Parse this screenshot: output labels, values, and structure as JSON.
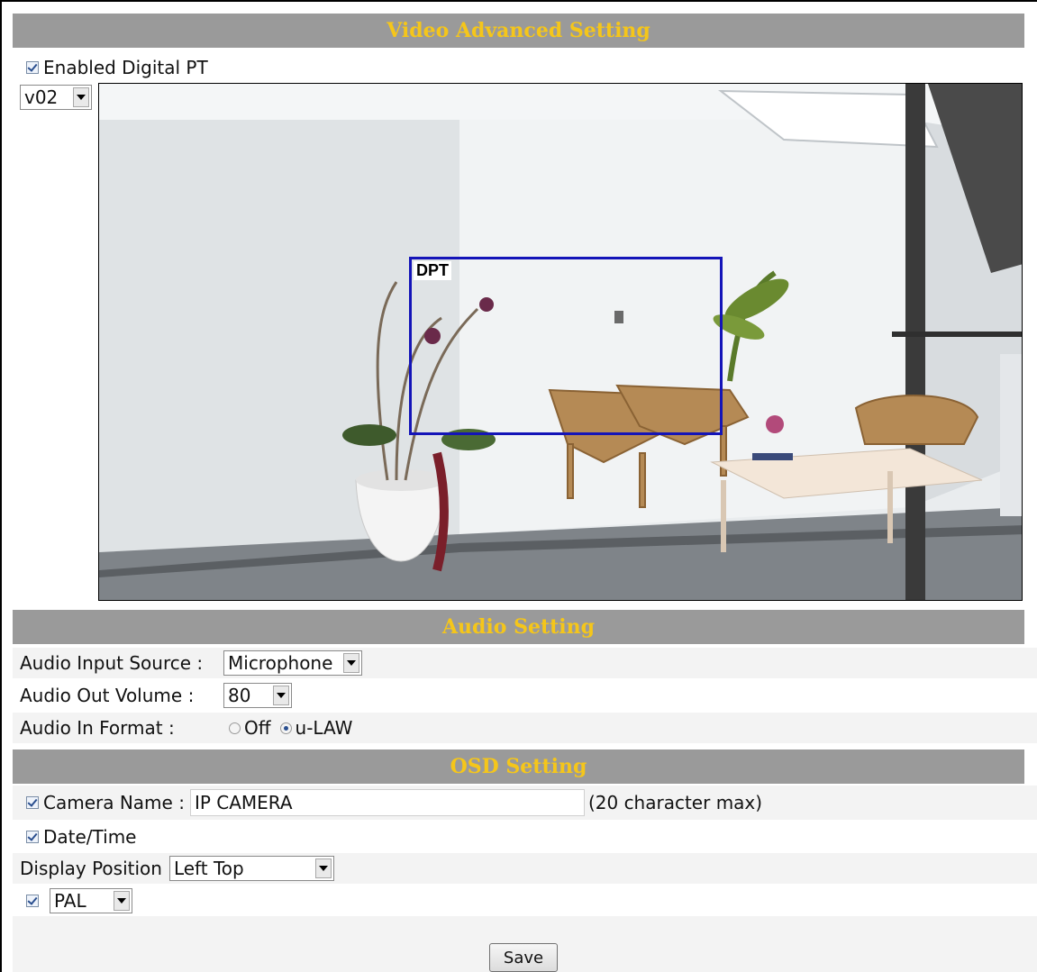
{
  "video_section": {
    "title": "Video Advanced Setting",
    "digital_pt_label": "Enabled Digital PT",
    "stream_select": "v02",
    "dpt_label": "DPT"
  },
  "audio_section": {
    "title": "Audio Setting",
    "input_source_label": "Audio Input Source :",
    "input_source_value": "Microphone",
    "out_volume_label": "Audio Out Volume :",
    "out_volume_value": "80",
    "in_format_label": "Audio In Format :",
    "format_off": "Off",
    "format_ulaw": "u-LAW"
  },
  "osd_section": {
    "title": "OSD Setting",
    "camera_name_label": "Camera Name :",
    "camera_name_value": "IP CAMERA",
    "camera_name_hint": "(20 character max)",
    "datetime_label": "Date/Time",
    "display_position_label": "Display Position",
    "display_position_value": "Left Top",
    "video_standard_value": "PAL"
  },
  "save_label": "Save",
  "colors": {
    "header_bg": "#9a9a9a",
    "header_text": "#f5c61a",
    "dpt_box": "#1414b8"
  }
}
